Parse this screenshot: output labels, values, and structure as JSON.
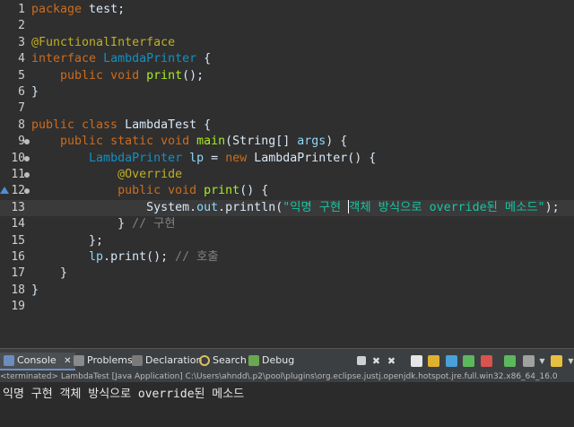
{
  "editor": {
    "lines": [
      {
        "n": "1",
        "tokens": [
          [
            "kw",
            "package"
          ],
          [
            "id",
            " test;"
          ]
        ]
      },
      {
        "n": "2",
        "tokens": []
      },
      {
        "n": "3",
        "tokens": [
          [
            "ann2",
            "@FunctionalInterface"
          ]
        ]
      },
      {
        "n": "4",
        "tokens": [
          [
            "kw",
            "interface "
          ],
          [
            "ty",
            "LambdaPrinter"
          ],
          [
            "id",
            " {"
          ]
        ]
      },
      {
        "n": "5",
        "tokens": [
          [
            "id",
            "    "
          ],
          [
            "kw",
            "public void "
          ],
          [
            "meth",
            "print"
          ],
          [
            "id",
            "();"
          ]
        ]
      },
      {
        "n": "6",
        "tokens": [
          [
            "id",
            "}"
          ]
        ]
      },
      {
        "n": "7",
        "tokens": []
      },
      {
        "n": "8",
        "tokens": [
          [
            "kw",
            "public class "
          ],
          [
            "id",
            "LambdaTest {"
          ]
        ]
      },
      {
        "n": "9",
        "fold": true,
        "tokens": [
          [
            "id",
            "    "
          ],
          [
            "kw",
            "public static void "
          ],
          [
            "meth",
            "main"
          ],
          [
            "id",
            "(String[] "
          ],
          [
            "fld",
            "args"
          ],
          [
            "id",
            ") {"
          ]
        ]
      },
      {
        "n": "10",
        "fold": true,
        "tokens": [
          [
            "id",
            "        "
          ],
          [
            "ty",
            "LambdaPrinter"
          ],
          [
            "id",
            " "
          ],
          [
            "fld",
            "lp"
          ],
          [
            "id",
            " = "
          ],
          [
            "kw",
            "new "
          ],
          [
            "id",
            "LambdaPrinter() {"
          ]
        ]
      },
      {
        "n": "11",
        "fold": true,
        "tokens": [
          [
            "id",
            "            "
          ],
          [
            "ann2",
            "@Override"
          ]
        ]
      },
      {
        "n": "12",
        "fold": true,
        "marker": true,
        "tokens": [
          [
            "id",
            "            "
          ],
          [
            "kw",
            "public void "
          ],
          [
            "meth",
            "print"
          ],
          [
            "id",
            "() {"
          ]
        ]
      },
      {
        "n": "13",
        "current": true,
        "tokens": [
          [
            "id",
            "                System."
          ],
          [
            "fld",
            "out"
          ],
          [
            "id",
            ".println("
          ],
          [
            "str",
            "\"익명 구현 "
          ],
          [
            "caret",
            ""
          ],
          [
            "str",
            "객체 방식으로 override된 메소드\""
          ],
          [
            "id",
            ");"
          ]
        ]
      },
      {
        "n": "14",
        "tokens": [
          [
            "id",
            "            } "
          ],
          [
            "cm",
            "// 구현"
          ]
        ]
      },
      {
        "n": "15",
        "tokens": [
          [
            "id",
            "        };"
          ]
        ]
      },
      {
        "n": "16",
        "tokens": [
          [
            "id",
            "        "
          ],
          [
            "fld",
            "lp"
          ],
          [
            "id",
            ".print(); "
          ],
          [
            "cm",
            "// 호출"
          ]
        ]
      },
      {
        "n": "17",
        "tokens": [
          [
            "id",
            "    }"
          ]
        ]
      },
      {
        "n": "18",
        "tokens": [
          [
            "id",
            "}"
          ]
        ]
      },
      {
        "n": "19",
        "tokens": []
      }
    ]
  },
  "panel": {
    "tabs": {
      "console": "Console",
      "problems": "Problems",
      "declaration": "Declaration",
      "search": "Search",
      "debug": "Debug"
    },
    "close_glyph": "✕",
    "status": "<terminated> LambdaTest [Java Application] C:\\Users\\ahndd\\.p2\\pool\\plugins\\org.eclipse.justj.openjdk.hotspot.jre.full.win32.x86_64_16.0",
    "output": "익명 구현 객체 방식으로 override된 메소드"
  },
  "colors": {
    "editor_bg": "#2f2f2f",
    "keyword": "#cc6c1d",
    "string": "#17c6a3",
    "comment": "#808080",
    "annotation": "#bfae27"
  }
}
